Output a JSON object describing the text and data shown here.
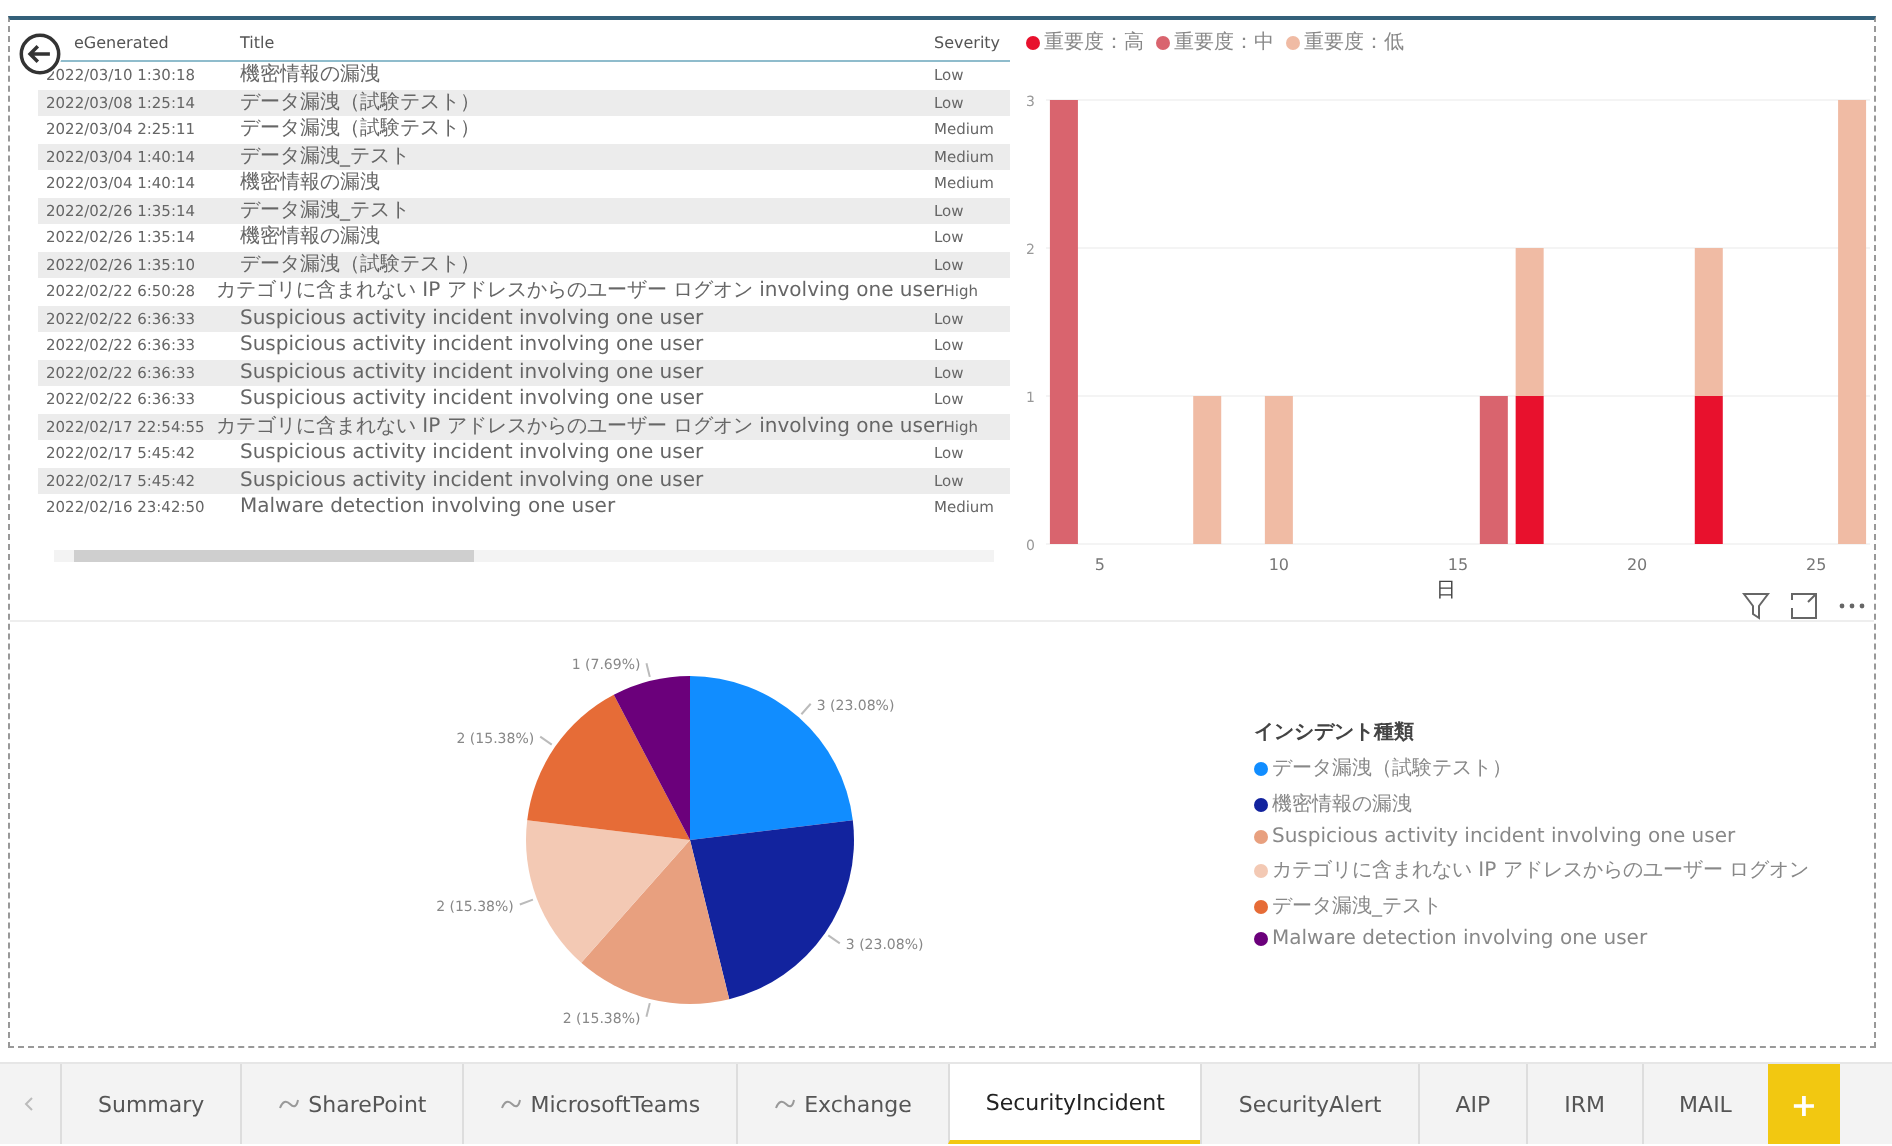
{
  "table": {
    "columns": [
      "eGenerated",
      "Title",
      "Severity"
    ],
    "rows": [
      [
        "2022/03/10 1:30:18",
        "機密情報の漏洩",
        "Low"
      ],
      [
        "2022/03/08 1:25:14",
        "データ漏洩（試験テスト）",
        "Low"
      ],
      [
        "2022/03/04 2:25:11",
        "データ漏洩（試験テスト）",
        "Medium"
      ],
      [
        "2022/03/04 1:40:14",
        "データ漏洩_テスト",
        "Medium"
      ],
      [
        "2022/03/04 1:40:14",
        "機密情報の漏洩",
        "Medium"
      ],
      [
        "2022/02/26 1:35:14",
        "データ漏洩_テスト",
        "Low"
      ],
      [
        "2022/02/26 1:35:14",
        "機密情報の漏洩",
        "Low"
      ],
      [
        "2022/02/26 1:35:10",
        "データ漏洩（試験テスト）",
        "Low"
      ],
      [
        "2022/02/22 6:50:28",
        "カテゴリに含まれない IP アドレスからのユーザー ログオン involving one user",
        "High"
      ],
      [
        "2022/02/22 6:36:33",
        "Suspicious activity incident involving one user",
        "Low"
      ],
      [
        "2022/02/22 6:36:33",
        "Suspicious activity incident involving one user",
        "Low"
      ],
      [
        "2022/02/22 6:36:33",
        "Suspicious activity incident involving one user",
        "Low"
      ],
      [
        "2022/02/22 6:36:33",
        "Suspicious activity incident involving one user",
        "Low"
      ],
      [
        "2022/02/17 22:54:55",
        "カテゴリに含まれない IP アドレスからのユーザー ログオン involving one user",
        "High"
      ],
      [
        "2022/02/17 5:45:42",
        "Suspicious activity incident involving one user",
        "Low"
      ],
      [
        "2022/02/17 5:45:42",
        "Suspicious activity incident involving one user",
        "Low"
      ],
      [
        "2022/02/16 23:42:50",
        "Malware detection involving one user",
        "Medium"
      ]
    ]
  },
  "bar_chart": {
    "chart_data": {
      "type": "bar",
      "stacked": true,
      "xlabel": "日",
      "x": [
        4,
        8,
        10,
        16,
        17,
        22,
        26
      ],
      "xlim": [
        3.5,
        26.5
      ],
      "xticks": [
        5,
        10,
        15,
        20,
        25
      ],
      "yticks": [
        0,
        1,
        2,
        3
      ],
      "ylim": [
        0,
        3
      ],
      "series": [
        {
          "name": "重要度：高",
          "color": "#e8112d",
          "values": [
            null,
            null,
            null,
            null,
            1,
            1,
            null
          ]
        },
        {
          "name": "重要度：中",
          "color": "#d9646e",
          "values": [
            3,
            null,
            null,
            1,
            null,
            null,
            null
          ]
        },
        {
          "name": "重要度：低",
          "color": "#f0bba4",
          "values": [
            null,
            1,
            1,
            null,
            1,
            1,
            3
          ]
        }
      ]
    }
  },
  "pie_chart": {
    "legend_title": "インシデント種類",
    "legend": [
      {
        "color": "#118dff"
      },
      {
        "color": "#12239e"
      },
      {
        "color": "#e8a07f"
      },
      {
        "color": "#f3c9b4"
      },
      {
        "color": "#e66c37"
      },
      {
        "color": "#6b007b"
      }
    ],
    "chart_data": {
      "type": "pie",
      "value_labels": [
        "3 (23.08%)",
        "3 (23.08%)",
        "2 (15.38%)",
        "2 (15.38%)",
        "2 (15.38%)",
        "1 (7.69%)"
      ],
      "categories": [
        "データ漏洩（試験テスト）",
        "機密情報の漏洩",
        "Suspicious activity incident involving one user",
        "カテゴリに含まれない IP アドレスからのユーザー ログオン",
        "データ漏洩_テスト",
        "Malware detection involving one user"
      ],
      "values": [
        3,
        3,
        2,
        2,
        2,
        1
      ]
    }
  },
  "tabs": [
    {
      "label": "Summary",
      "icon": false,
      "selected": false
    },
    {
      "label": "SharePoint",
      "icon": true,
      "selected": false
    },
    {
      "label": "MicrosoftTeams",
      "icon": true,
      "selected": false
    },
    {
      "label": "Exchange",
      "icon": true,
      "selected": false
    },
    {
      "label": "SecurityIncident",
      "icon": false,
      "selected": true
    },
    {
      "label": "SecurityAlert",
      "icon": false,
      "selected": false
    },
    {
      "label": "AIP",
      "icon": false,
      "selected": false
    },
    {
      "label": "IRM",
      "icon": false,
      "selected": false
    },
    {
      "label": "MAIL",
      "icon": false,
      "selected": false
    }
  ],
  "add_tab": "+"
}
